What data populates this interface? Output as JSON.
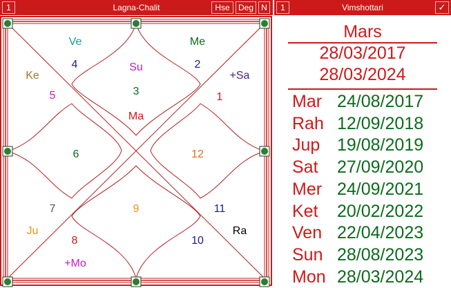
{
  "left_panel": {
    "number_button": "1",
    "title": "Lagna-Chalit",
    "buttons": {
      "hse": "Hse",
      "deg": "Deg",
      "n": "N"
    }
  },
  "right_panel": {
    "number_button": "1",
    "title": "Vimshottari",
    "check_icon": "check-icon",
    "mahadasha": {
      "planet": "Mars",
      "start": "28/03/2017",
      "end": "28/03/2024"
    },
    "antardasha": [
      {
        "planet": "Mar",
        "date": "24/08/2017"
      },
      {
        "planet": "Rah",
        "date": "12/09/2018"
      },
      {
        "planet": "Jup",
        "date": "19/08/2019"
      },
      {
        "planet": "Sat",
        "date": "27/09/2020"
      },
      {
        "planet": "Mer",
        "date": "24/09/2021"
      },
      {
        "planet": "Ket",
        "date": "20/02/2022"
      },
      {
        "planet": "Ven",
        "date": "22/04/2023"
      },
      {
        "planet": "Sun",
        "date": "28/08/2023"
      },
      {
        "planet": "Mon",
        "date": "28/03/2024"
      }
    ]
  },
  "chart": {
    "house_numbers": {
      "h1": "1",
      "h2": "2",
      "h3": "3",
      "h4": "4",
      "h5": "5",
      "h6": "6",
      "h7": "7",
      "h8": "8",
      "h9": "9",
      "h10": "10",
      "h11": "11",
      "h12": "12"
    },
    "planets": {
      "ve": "Ve",
      "me": "Me",
      "ke": "Ke",
      "su": "Su",
      "sa": "+Sa",
      "ma": "Ma",
      "ju": "Ju",
      "ra": "Ra",
      "mo": "+Mo"
    },
    "colors": {
      "frame": "#cc1a1a",
      "lines": "#b01e1e",
      "handle_fill": "#2e7d32",
      "handle_border": "#1b3d1b"
    }
  }
}
